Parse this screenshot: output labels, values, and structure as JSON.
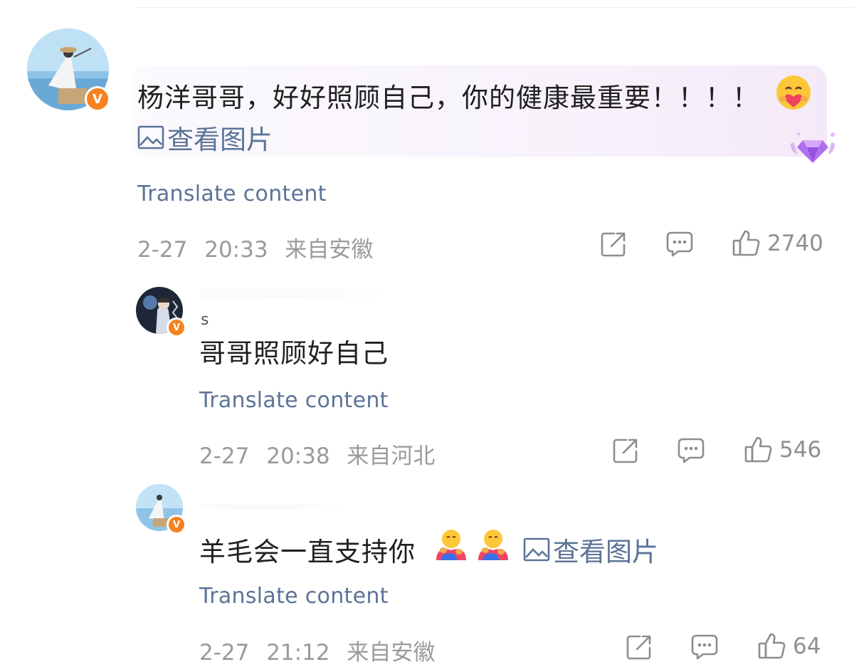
{
  "comments": [
    {
      "text": "杨洋哥哥，好好照顾自己，你的健康最重要！！！！",
      "view_image": "查看图片",
      "translate": "Translate content",
      "date": "2-27",
      "time": "20:33",
      "location": "来自安徽",
      "likes": "2740",
      "badge_letter": "V"
    },
    {
      "username": "s",
      "text": "哥哥照顾好自己",
      "translate": "Translate content",
      "date": "2-27",
      "time": "20:38",
      "location": "来自河北",
      "likes": "546",
      "badge_letter": "V"
    },
    {
      "text": "羊毛会一直支持你",
      "view_image": "查看图片",
      "translate": "Translate content",
      "date": "2-27",
      "time": "21:12",
      "location": "来自安徽",
      "likes": "64",
      "badge_letter": "V"
    }
  ],
  "colors": {
    "link": "#5c7397",
    "meta": "#9a9a9a",
    "badge": "#f5811f",
    "bubble": "#f7f1fb"
  },
  "icons": [
    "share-icon",
    "comment-icon",
    "thumbs-up-icon",
    "image-icon",
    "gem-badge-icon",
    "verified-badge-icon"
  ]
}
